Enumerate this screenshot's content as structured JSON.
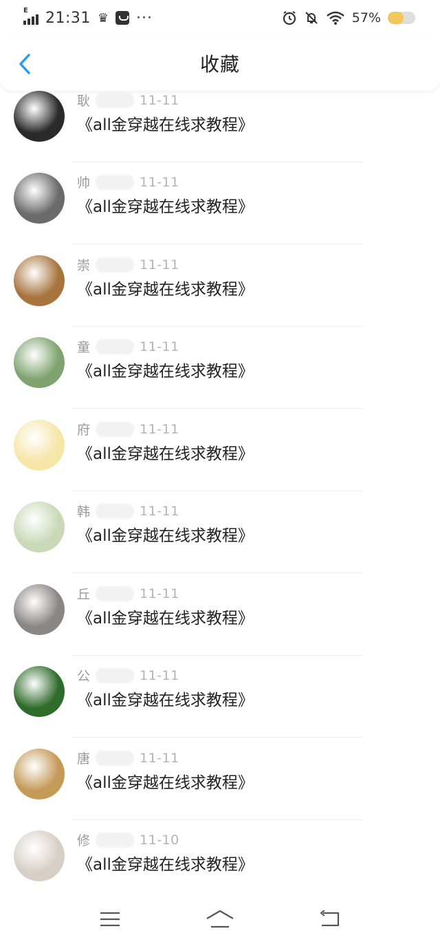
{
  "status_bar": {
    "network_type": "E",
    "time": "21:31",
    "more": "···",
    "battery_percent": "57%",
    "battery_level": 0.57,
    "icons": [
      "signal-icon",
      "crown-icon",
      "message-box-icon",
      "alarm-icon",
      "bell-off-icon",
      "wifi-icon",
      "battery-icon"
    ]
  },
  "header": {
    "title": "收藏",
    "back_icon": "chevron-left-icon",
    "accent_color": "#2b9af3"
  },
  "favorites": [
    {
      "name": "耿",
      "date": "11-11",
      "title": "《all金穿越在线求教程》",
      "avatar_color": "#2a2a2a"
    },
    {
      "name": "帅",
      "date": "11-11",
      "title": "《all金穿越在线求教程》",
      "avatar_color": "#6b6b6b"
    },
    {
      "name": "崇",
      "date": "11-11",
      "title": "《all金穿越在线求教程》",
      "avatar_color": "#a7743d"
    },
    {
      "name": "童",
      "date": "11-11",
      "title": "《all金穿越在线求教程》",
      "avatar_color": "#7fa36f"
    },
    {
      "name": "府",
      "date": "11-11",
      "title": "《all金穿越在线求教程》",
      "avatar_color": "#f6e6a8"
    },
    {
      "name": "韩",
      "date": "11-11",
      "title": "《all金穿越在线求教程》",
      "avatar_color": "#c9d9b8"
    },
    {
      "name": "丘",
      "date": "11-11",
      "title": "《all金穿越在线求教程》",
      "avatar_color": "#8a8684"
    },
    {
      "name": "公",
      "date": "11-11",
      "title": "《all金穿越在线求教程》",
      "avatar_color": "#2f6b2a"
    },
    {
      "name": "唐",
      "date": "11-11",
      "title": "《all金穿越在线求教程》",
      "avatar_color": "#c49a57"
    },
    {
      "name": "修",
      "date": "11-10",
      "title": "《all金穿越在线求教程》",
      "avatar_color": "#d7cfc6"
    }
  ],
  "nav_bar": {
    "icons": [
      "menu-icon",
      "home-icon",
      "back-icon"
    ]
  }
}
